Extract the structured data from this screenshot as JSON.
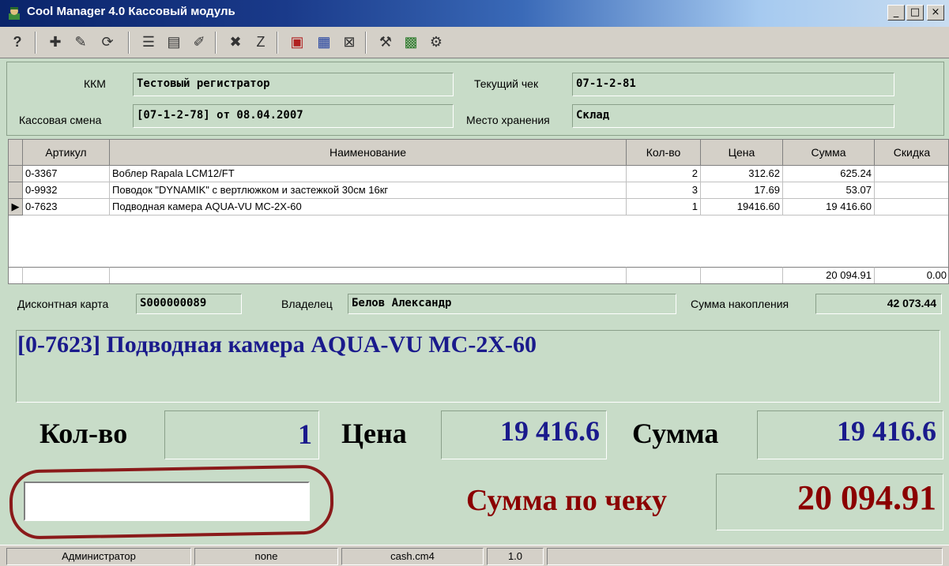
{
  "window": {
    "title": "Cool Manager 4.0  Кассовый модуль",
    "minimize": "_",
    "maximize": "□",
    "close": "×"
  },
  "toolbar": {
    "icons": [
      "help-icon",
      "add-item-icon",
      "edit-item-icon",
      "refresh-icon",
      "item-list-icon",
      "item-info-icon",
      "item-edit-icon",
      "delete-item-icon",
      "item-z-icon",
      "cash-register-icon",
      "receipt-icon",
      "close-receipt-icon",
      "tools-icon",
      "report-icon",
      "settings-icon"
    ]
  },
  "info": {
    "kkm_label": "ККМ",
    "kkm_value": "Тестовый регистратор",
    "current_check_label": "Текущий чек",
    "current_check_value": "07-1-2-81",
    "shift_label": "Кассовая смена",
    "shift_value": "[07-1-2-78] от 08.04.2007",
    "storage_label": "Место хранения",
    "storage_value": "Склад"
  },
  "grid": {
    "columns": [
      "Артикул",
      "Наименование",
      "Кол-во",
      "Цена",
      "Сумма",
      "Скидка"
    ],
    "rows": [
      {
        "article": "0-3367",
        "name": "Воблер Rapala LCM12/FT",
        "qty": "2",
        "price": "312.62",
        "sum": "625.24",
        "discount": ""
      },
      {
        "article": "0-9932",
        "name": "Поводок \"DYNAMIK\" с вертлюжком и застежкой 30см 16кг",
        "qty": "3",
        "price": "17.69",
        "sum": "53.07",
        "discount": ""
      },
      {
        "article": "0-7623",
        "name": "Подводная камера  AQUA-VU  MC-2X-60",
        "qty": "1",
        "price": "19416.60",
        "sum": "19 416.60",
        "discount": ""
      }
    ],
    "current_row_marker": "▶",
    "totals": {
      "sum": "20 094.91",
      "discount": "0.00"
    }
  },
  "discount": {
    "card_label": "Дисконтная карта",
    "card_value": "S000000089",
    "owner_label": "Владелец",
    "owner_value": "Белов Александр",
    "accum_label": "Сумма накопления",
    "accum_value": "42 073.44"
  },
  "product": {
    "name": "[0-7623] Подводная камера  AQUA-VU  MC-2X-60",
    "qty_label": "Кол-во",
    "qty_value": "1",
    "price_label": "Цена",
    "price_value": "19 416.6",
    "sum_label": "Сумма",
    "sum_value": "19 416.6",
    "total_label": "Сумма по чеку",
    "total_value": "20 094.91",
    "input_value": ""
  },
  "status": {
    "user": "Администратор",
    "field2": "none",
    "file": "cash.cm4",
    "version": "1.0"
  },
  "colors": {
    "background": "#c8dcc8",
    "product_name": "#1a1a8c",
    "numbers_blue": "#1a1a8c",
    "total_red": "#8b0000",
    "annotation_circle": "#8a1a1a"
  }
}
